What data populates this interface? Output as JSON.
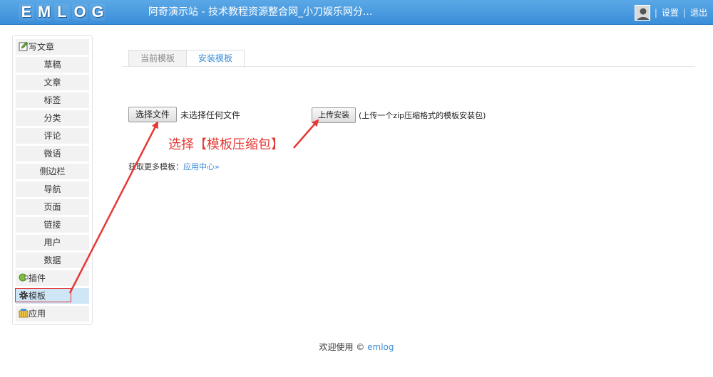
{
  "header": {
    "logo_letters": [
      "E",
      "M",
      "L",
      "O",
      "G"
    ],
    "site_title": "阿奇演示站 - 技术教程资源整合网_小刀娱乐网分...",
    "settings": "设置",
    "logout": "退出",
    "separator": "|"
  },
  "sidebar": {
    "items": [
      {
        "label": "写文章",
        "icon": "edit-icon"
      },
      {
        "label": "草稿"
      },
      {
        "label": "文章"
      },
      {
        "label": "标签"
      },
      {
        "label": "分类"
      },
      {
        "label": "评论"
      },
      {
        "label": "微语"
      },
      {
        "label": "侧边栏"
      },
      {
        "label": "导航"
      },
      {
        "label": "页面"
      },
      {
        "label": "链接"
      },
      {
        "label": "用户"
      },
      {
        "label": "数据"
      },
      {
        "label": "插件",
        "icon": "plugin-icon"
      },
      {
        "label": "模板",
        "icon": "gear-icon",
        "active": true
      },
      {
        "label": "应用",
        "icon": "app-store-icon"
      }
    ]
  },
  "tabs": {
    "current_template": "当前模板",
    "install_template": "安装模板"
  },
  "upload": {
    "choose_file": "选择文件",
    "no_file": "未选择任何文件",
    "upload_install": "上传安装",
    "hint": "(上传一个zip压缩格式的模板安装包)"
  },
  "annotation": "选择【模板压缩包】",
  "more": {
    "text": "获取更多模板：",
    "link": "应用中心»"
  },
  "footer": {
    "text": "欢迎使用 ©",
    "link": "emlog"
  },
  "colors": {
    "header": "#3a8dd8",
    "link": "#3a8dd8",
    "annotation": "#e53935",
    "active_nav": "#cfe6f7"
  }
}
